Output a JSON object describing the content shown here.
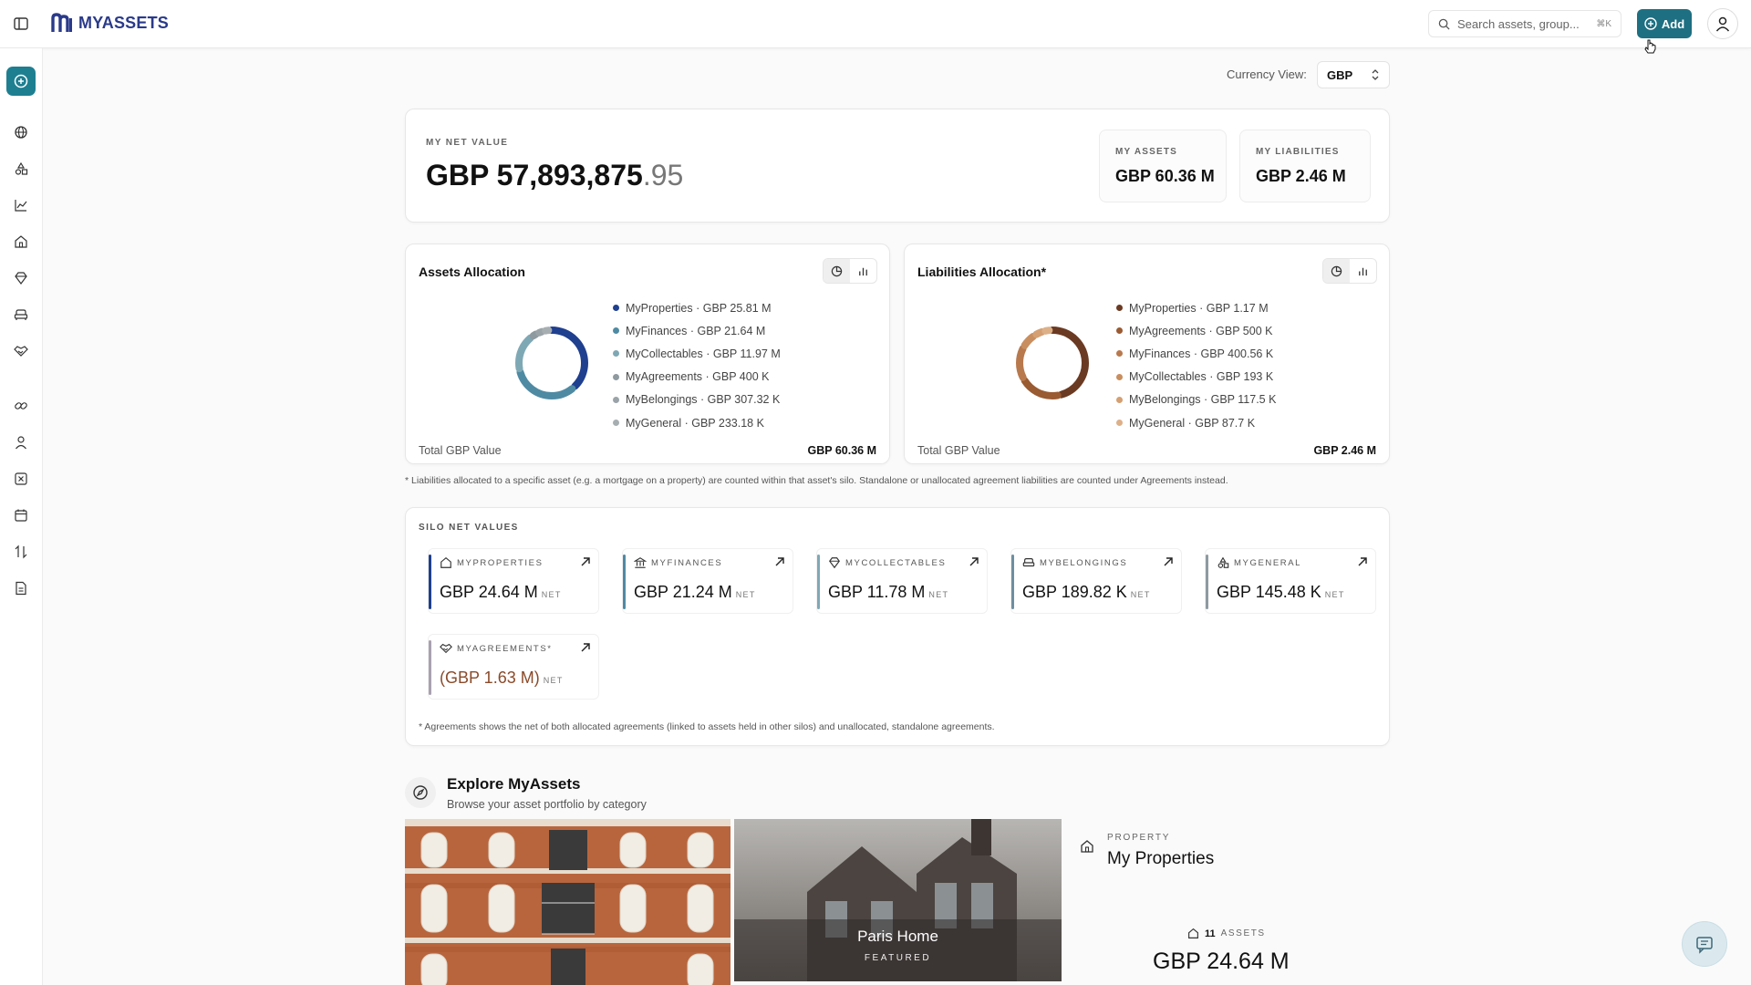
{
  "header": {
    "brand": "MYASSETS",
    "search_placeholder": "Search assets, group...",
    "search_shortcut": "⌘K",
    "add_label": "Add"
  },
  "currency": {
    "label": "Currency View:",
    "value": "GBP"
  },
  "net_value": {
    "label": "MY NET VALUE",
    "value_main": "GBP 57,893,875",
    "value_decimal": ".95",
    "assets_label": "MY ASSETS",
    "assets_value": "GBP 60.36 M",
    "liabilities_label": "MY LIABILITIES",
    "liabilities_value": "GBP 2.46 M"
  },
  "assets_allocation": {
    "title": "Assets Allocation",
    "items": [
      {
        "label": "MyProperties · GBP 25.81 M",
        "value": 25.81,
        "color": "#1f3f8f"
      },
      {
        "label": "MyFinances · GBP 21.64 M",
        "value": 21.64,
        "color": "#4f8aa3"
      },
      {
        "label": "MyCollectables · GBP 11.97 M",
        "value": 11.97,
        "color": "#7fa8b5"
      },
      {
        "label": "MyAgreements · GBP 400 K",
        "value": 0.4,
        "color": "#8e9aa0"
      },
      {
        "label": "MyBelongings · GBP 307.32 K",
        "value": 0.30732,
        "color": "#9aa3a8"
      },
      {
        "label": "MyGeneral · GBP 233.18 K",
        "value": 0.23318,
        "color": "#a7aeb2"
      }
    ],
    "total_label": "Total GBP Value",
    "total_value": "GBP 60.36 M"
  },
  "liabilities_allocation": {
    "title": "Liabilities Allocation*",
    "items": [
      {
        "label": "MyProperties · GBP 1.17 M",
        "value": 1.17,
        "color": "#6b3a22"
      },
      {
        "label": "MyAgreements · GBP 500 K",
        "value": 0.5,
        "color": "#9a5a32"
      },
      {
        "label": "MyFinances · GBP 400.56 K",
        "value": 0.40056,
        "color": "#b8794d"
      },
      {
        "label": "MyCollectables · GBP 193 K",
        "value": 0.193,
        "color": "#c98e5f"
      },
      {
        "label": "MyBelongings · GBP 117.5 K",
        "value": 0.1175,
        "color": "#d49f72"
      },
      {
        "label": "MyGeneral · GBP 87.7 K",
        "value": 0.0877,
        "color": "#ddb088"
      }
    ],
    "total_label": "Total GBP Value",
    "total_value": "GBP 2.46 M"
  },
  "allocation_note": "* Liabilities allocated to a specific asset (e.g. a mortgage on a property) are counted within that asset's silo. Standalone or unallocated agreement liabilities are counted under Agreements instead.",
  "silo": {
    "heading": "SILO NET VALUES",
    "net_label": "NET",
    "items": [
      {
        "name": "MYPROPERTIES",
        "value": "GBP 24.64 M",
        "bar": "#1f3f8f",
        "icon": "home-icon"
      },
      {
        "name": "MYFINANCES",
        "value": "GBP 21.24 M",
        "bar": "#4f8aa3",
        "icon": "bank-icon"
      },
      {
        "name": "MYCOLLECTABLES",
        "value": "GBP 11.78 M",
        "bar": "#7fa8b5",
        "icon": "gem-icon"
      },
      {
        "name": "MYBELONGINGS",
        "value": "GBP 189.82 K",
        "bar": "#6f8fa0",
        "icon": "sofa-icon"
      },
      {
        "name": "MYGENERAL",
        "value": "GBP 145.48 K",
        "bar": "#8e9aa0",
        "icon": "shapes-icon"
      },
      {
        "name": "MYAGREEMENTS*",
        "value": "(GBP 1.63 M)",
        "bar": "#a9a0b0",
        "icon": "handshake-icon"
      }
    ],
    "note": "* Agreements shows the net of both allocated agreements (linked to assets held in other silos) and unallocated, standalone agreements."
  },
  "explore": {
    "title": "Explore MyAssets",
    "subtitle": "Browse your asset portfolio by category",
    "featured_title": "Paris Home",
    "featured_label": "FEATURED",
    "category_label": "PROPERTY",
    "category_title": "My Properties",
    "asset_count": "11",
    "asset_count_label": "ASSETS",
    "category_value": "GBP 24.64 M"
  }
}
